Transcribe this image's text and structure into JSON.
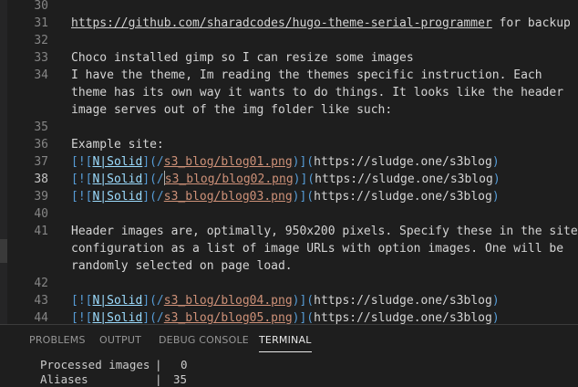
{
  "editor": {
    "current_line": "38",
    "lines": [
      {
        "n": "30",
        "text": ""
      },
      {
        "n": "31",
        "url": "https://github.com/sharadcodes/hugo-theme-serial-programmer",
        "after": " for backup"
      },
      {
        "n": "32",
        "text": ""
      },
      {
        "n": "33",
        "text": "Choco installed gimp so I can resize some images"
      },
      {
        "n": "34",
        "text": "I have the theme, Im reading the themes specific instruction. Each"
      },
      {
        "n": "",
        "text": "theme has its own way it wants to do things. It looks like the header"
      },
      {
        "n": "",
        "text": "image serves out of the img folder like such:"
      },
      {
        "n": "35",
        "text": ""
      },
      {
        "n": "36",
        "text": "Example site:"
      },
      {
        "n": "37",
        "md": {
          "p1": "[![",
          "alt": "N|Solid",
          "p2": "](/",
          "img": "s3_blog/blog01.png",
          "p3": ")](",
          "link": "https://sludge.one/s3blog",
          "p4": ")"
        }
      },
      {
        "n": "38",
        "md": {
          "p1": "[![",
          "alt": "N|Solid",
          "p2": "](/",
          "img": "s3_blog/blog02.png",
          "p3": ")](",
          "link": "https://sludge.one/s3blog",
          "p4": ")"
        }
      },
      {
        "n": "39",
        "md": {
          "p1": "[![",
          "alt": "N|Solid",
          "p2": "](/",
          "img": "s3_blog/blog03.png",
          "p3": ")](",
          "link": "https://sludge.one/s3blog",
          "p4": ")"
        }
      },
      {
        "n": "40",
        "text": ""
      },
      {
        "n": "41",
        "text": "Header images are, optimally, 950x200 pixels. Specify these in the site"
      },
      {
        "n": "",
        "text": "configuration as a list of image URLs with option images. One will be"
      },
      {
        "n": "",
        "text": "randomly selected on page load."
      },
      {
        "n": "42",
        "text": ""
      },
      {
        "n": "43",
        "md": {
          "p1": "[![",
          "alt": "N|Solid",
          "p2": "](/",
          "img": "s3_blog/blog04.png",
          "p3": ")](",
          "link": "https://sludge.one/s3blog",
          "p4": ")"
        }
      },
      {
        "n": "44",
        "md": {
          "p1": "[![",
          "alt": "N|Solid",
          "p2": "](/",
          "img": "s3_blog/blog05.png",
          "p3": ")](",
          "link": "https://sludge.one/s3blog",
          "p4": ")"
        }
      }
    ]
  },
  "panel": {
    "tabs": [
      {
        "label": "PROBLEMS",
        "active": false
      },
      {
        "label": "OUTPUT",
        "active": false
      },
      {
        "label": "DEBUG CONSOLE",
        "active": false
      },
      {
        "label": "TERMINAL",
        "active": true
      }
    ],
    "terminal": [
      {
        "label": "Processed images",
        "value": "0"
      },
      {
        "label": "Aliases",
        "value": "35"
      }
    ]
  }
}
